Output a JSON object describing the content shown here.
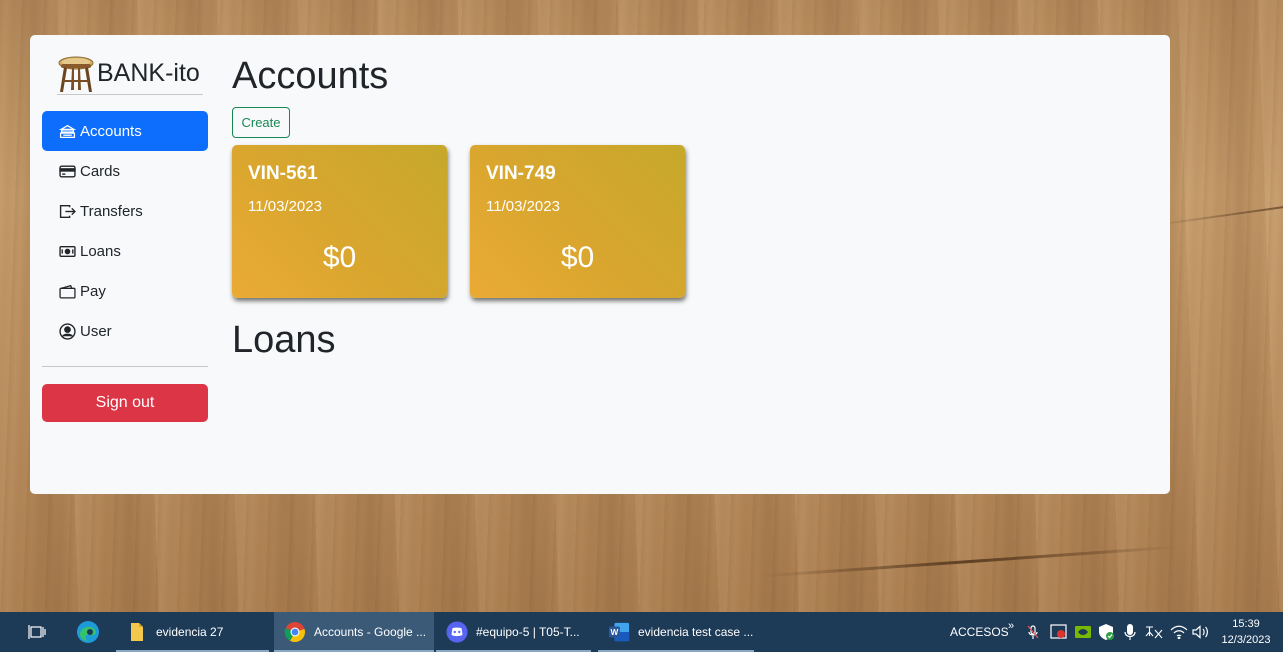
{
  "app": {
    "brand_name": "BANK-ito",
    "sidebar": {
      "items": [
        {
          "label": "Accounts",
          "icon": "bank-icon"
        },
        {
          "label": "Cards",
          "icon": "credit-card-icon"
        },
        {
          "label": "Transfers",
          "icon": "transfer-icon"
        },
        {
          "label": "Loans",
          "icon": "cash-icon"
        },
        {
          "label": "Pay",
          "icon": "wallet-icon"
        },
        {
          "label": "User",
          "icon": "user-circle-icon"
        }
      ],
      "active_index": 0,
      "signout_label": "Sign out"
    },
    "main": {
      "title": "Accounts",
      "create_label": "Create",
      "accounts": [
        {
          "number": "VIN-561",
          "date": "11/03/2023",
          "balance": "$0"
        },
        {
          "number": "VIN-749",
          "date": "11/03/2023",
          "balance": "$0"
        }
      ],
      "loans_title": "Loans"
    },
    "colors": {
      "primary": "#0d6efd",
      "danger": "#dc3545",
      "success": "#198754",
      "card_gradient_start": "#eaab35",
      "card_gradient_end": "#c6a82b"
    }
  },
  "taskbar": {
    "apps": [
      {
        "label": "evidencia 27",
        "icon": "folder-icon"
      },
      {
        "label": "Accounts - Google ...",
        "icon": "chrome-icon"
      },
      {
        "label": "#equipo-5 | T05-T...",
        "icon": "discord-icon"
      },
      {
        "label": "evidencia test case ...",
        "icon": "word-icon"
      }
    ],
    "tray_label": "ACCESOS",
    "time": "15:39",
    "date": "12/3/2023"
  }
}
